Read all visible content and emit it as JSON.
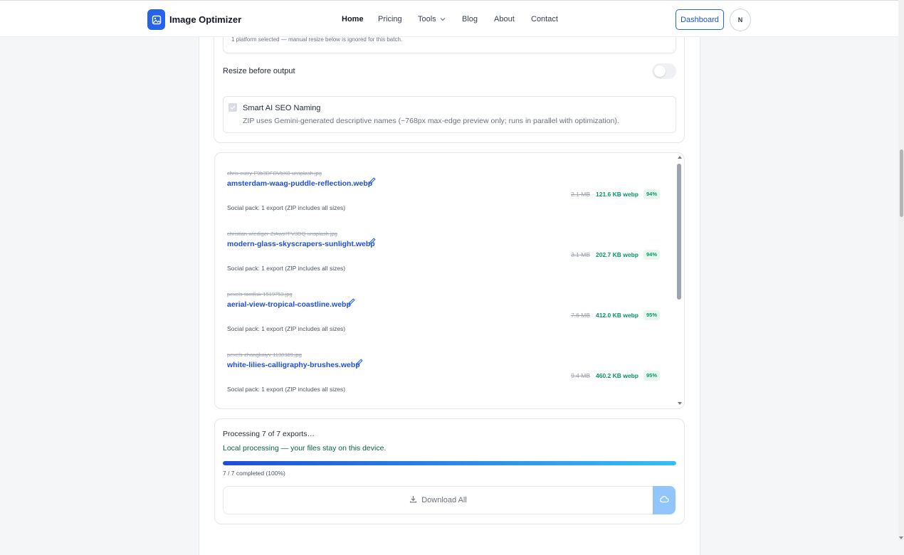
{
  "app": {
    "name": "Image Optimizer"
  },
  "nav": {
    "home": "Home",
    "pricing": "Pricing",
    "tools": "Tools",
    "blog": "Blog",
    "about": "About",
    "contact": "Contact"
  },
  "header": {
    "dashboard_label": "Dashboard",
    "avatar_initial": "N"
  },
  "settings": {
    "platform_note": "1 platform selected — manual resize below is ignored for this batch.",
    "resize_label": "Resize before output",
    "resize_enabled": false,
    "seo_title": "Smart AI SEO Naming",
    "seo_desc": "ZIP uses Gemini-generated descriptive names (~768px max-edge preview only; runs in parallel with optimization).",
    "seo_checked": false
  },
  "files": [
    {
      "original": "chris-curry-F9b3DFDVbX8-unsplash.jpg",
      "renamed": "amsterdam-waag-puddle-reflection.webp",
      "note": "Social pack: 1 export (ZIP includes all sizes)",
      "old_size": "2.1 MB",
      "new_size": "121.6 KB webp",
      "saving": "94%"
    },
    {
      "original": "christian-wiediger-ZiAws7FV3DQ-unsplash.jpg",
      "renamed": "modern-glass-skyscrapers-sunlight.webp",
      "note": "Social pack: 1 export (ZIP includes all sizes)",
      "old_size": "3.1 MB",
      "new_size": "202.7 KB webp",
      "saving": "94%"
    },
    {
      "original": "pexels-tomfisk-1519753.jpg",
      "renamed": "aerial-view-tropical-coastline.webp",
      "note": "Social pack: 1 export (ZIP includes all sizes)",
      "old_size": "7.6 MB",
      "new_size": "412.0 KB webp",
      "saving": "95%"
    },
    {
      "original": "pexels-zhangkaiyv-1138369.jpg",
      "renamed": "white-lilies-calligraphy-brushes.webp",
      "note": "Social pack: 1 export (ZIP includes all sizes)",
      "old_size": "9.4 MB",
      "new_size": "460.2 KB webp",
      "saving": "95%"
    }
  ],
  "progress": {
    "title": "Processing 7 of 7 exports…",
    "local_note": "Local processing — your files stay on this device.",
    "count": "7 / 7 completed (100%)",
    "fraction": 1.0,
    "download_label": "Download All"
  },
  "colors": {
    "accent": "#2563eb",
    "link": "#1d4ed8",
    "success": "#059669",
    "cloud_button": "#93c5fd"
  },
  "icons": [
    "image-logo-icon",
    "chevron-down-icon",
    "pencil-icon",
    "download-icon",
    "cloud-icon",
    "check-icon"
  ]
}
